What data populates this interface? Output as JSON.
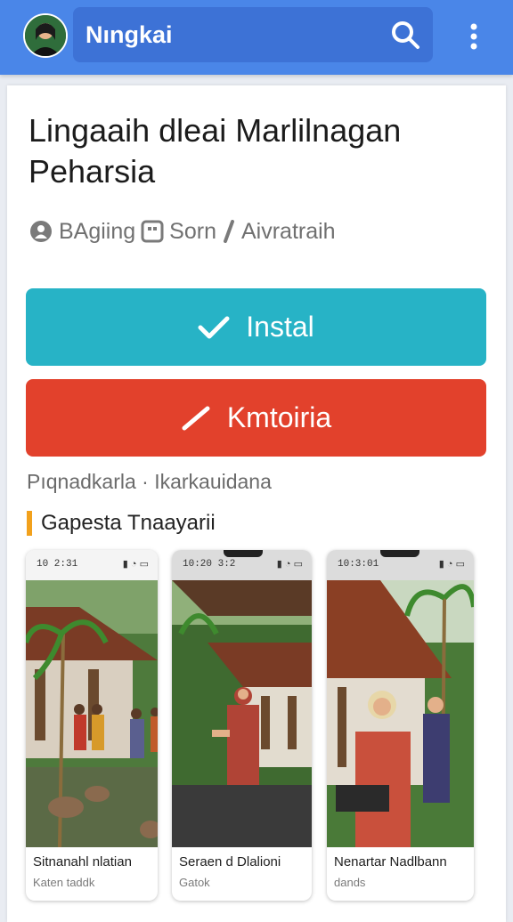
{
  "header": {
    "title": "Nıngkai",
    "avatar_icon": "user-avatar",
    "search_icon": "search-icon",
    "more_icon": "more-vert-icon"
  },
  "app": {
    "title": "Lingaaih dleai Marlilnagan Peharsia",
    "meta": {
      "developer": "BAgiing",
      "rating": "Sorn",
      "size": "Aivratraih"
    }
  },
  "buttons": {
    "install_label": "Instal",
    "secondary_label": "Kmtoiria"
  },
  "category_line": "Pıqnadkarla · Ikarkauidana",
  "screenshots": {
    "section_title": "Gapesta Tnaayarii",
    "items": [
      {
        "time": "10 2:31",
        "caption": "Sitnanahl nlatian",
        "sub": "Katen taddk"
      },
      {
        "time": "10:20 3:2",
        "caption": "Seraen d Dlalioni",
        "sub": "Gatok"
      },
      {
        "time": "10:3:01",
        "caption": "Nenartar Nadlbann",
        "sub": "dands"
      }
    ]
  },
  "colors": {
    "appbar": "#4a86e8",
    "install": "#27b3c6",
    "secondary": "#e2412c",
    "section_accent": "#f2a11c"
  }
}
